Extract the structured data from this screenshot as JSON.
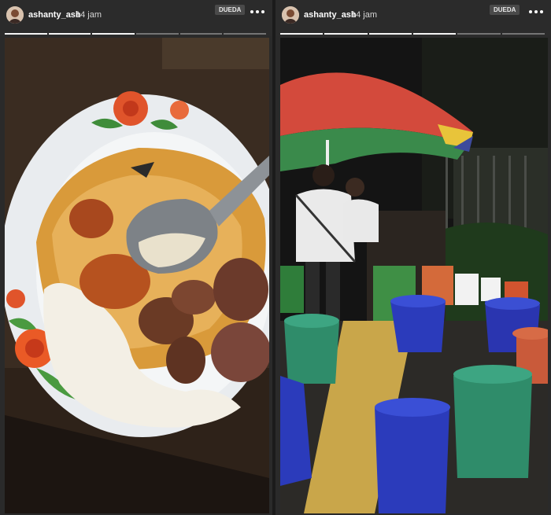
{
  "stories": [
    {
      "username": "ashanty_ash",
      "time": "14 jam",
      "badge": "DUEDA",
      "photo_subject": "plate of rice with curry and meat on wooden table"
    },
    {
      "username": "ashanty_ash",
      "time": "14 jam",
      "badge": "DUEDA",
      "photo_subject": "street food stall at night with umbrella and plastic stools"
    }
  ],
  "icons": {
    "avatar": "avatar-icon",
    "more": "more-options-icon"
  },
  "colors": {
    "header_bg": "#2b2b2b",
    "text": "#ffffff"
  }
}
